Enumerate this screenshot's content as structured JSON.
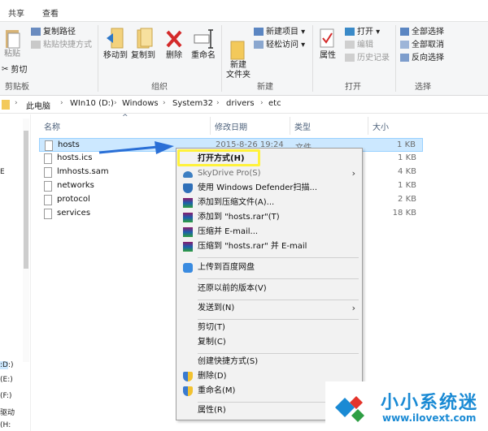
{
  "ribbon": {
    "tabs": [
      "共享",
      "查看"
    ],
    "clipboard": {
      "pin": "粘贴",
      "copy_path": "复制路径",
      "paste_shortcut": "粘贴快捷方式",
      "cut": "剪切",
      "label": "剪贴板"
    },
    "organize": {
      "move_to": "移动到",
      "copy_to": "复制到",
      "delete": "删除",
      "rename": "重命名",
      "label": "组织"
    },
    "new": {
      "new_folder": "新建\n文件夹",
      "new_item": "新建项目",
      "easy_access": "轻松访问",
      "label": "新建"
    },
    "open": {
      "properties": "属性",
      "open": "打开",
      "edit": "编辑",
      "history": "历史记录",
      "label": "打开"
    },
    "select": {
      "select_all": "全部选择",
      "select_none": "全部取消",
      "invert": "反向选择",
      "label": "选择"
    }
  },
  "address": {
    "crumbs": [
      "此电脑",
      "WIn10 (D:)",
      "Windows",
      "System32",
      "drivers",
      "etc"
    ]
  },
  "nav": {
    "items": [
      "E",
      ":D:)",
      "(E:)",
      "(F:)",
      "驱动",
      "(H:"
    ]
  },
  "columns": {
    "name": "名称",
    "date": "修改日期",
    "type": "类型",
    "size": "大小"
  },
  "files": [
    {
      "name": "hosts",
      "date": "2015-8-26 19:24",
      "type": "文件",
      "size": "1 KB"
    },
    {
      "name": "hosts.ics",
      "date": "",
      "type": "",
      "size": "1 KB"
    },
    {
      "name": "lmhosts.sam",
      "date": "",
      "type": "",
      "size": "4 KB"
    },
    {
      "name": "networks",
      "date": "",
      "type": "",
      "size": "1 KB"
    },
    {
      "name": "protocol",
      "date": "",
      "type": "",
      "size": "2 KB"
    },
    {
      "name": "services",
      "date": "",
      "type": "",
      "size": "18 KB"
    }
  ],
  "context_menu": {
    "open_with": "打开方式(H)",
    "skydrive": "SkyDrive Pro(S)",
    "defender": "使用 Windows Defender扫描...",
    "add_archive": "添加到压缩文件(A)...",
    "add_rar": "添加到 \"hosts.rar\"(T)",
    "compress_email": "压缩并 E-mail...",
    "compress_rar_email": "压缩到 \"hosts.rar\" 并 E-mail",
    "upload_baidu": "上传到百度网盘",
    "restore": "还原以前的版本(V)",
    "send_to": "发送到(N)",
    "cut": "剪切(T)",
    "copy": "复制(C)",
    "create_shortcut": "创建快捷方式(S)",
    "delete": "删除(D)",
    "rename": "重命名(M)",
    "properties": "属性(R)"
  },
  "watermark": {
    "title": "小小系统迷",
    "url": "www.ilovext.com"
  },
  "colors": {
    "selection": "#cce8ff",
    "highlight": "#fff23a",
    "accent": "#1a8ad4",
    "arrow": "#2a6fd6"
  }
}
